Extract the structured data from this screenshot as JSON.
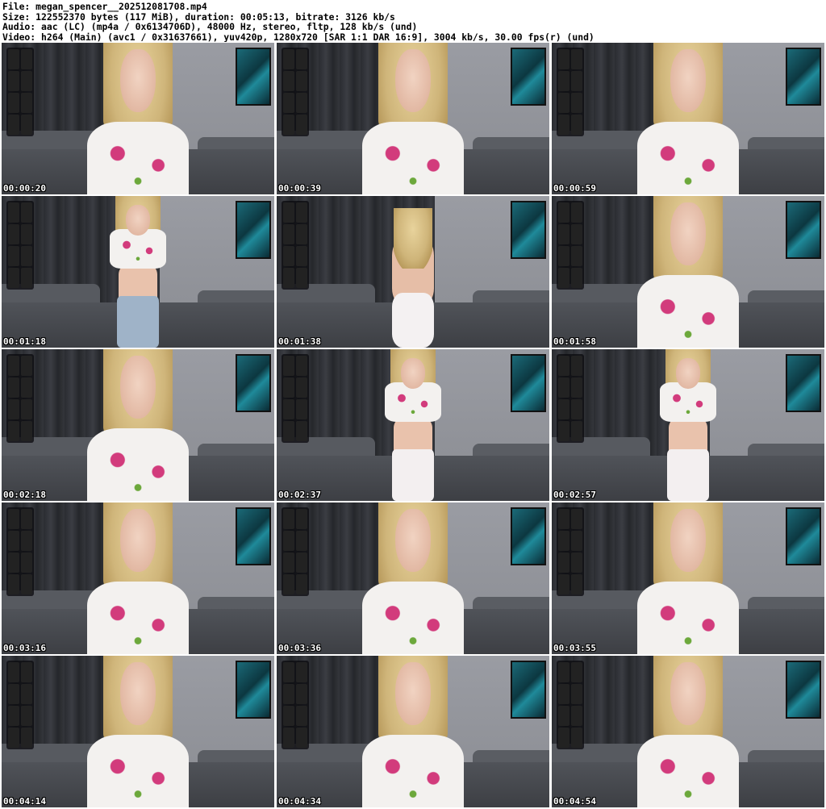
{
  "header": {
    "file": "File: megan_spencer__202512081708.mp4",
    "size": "Size: 122552370 bytes (117 MiB), duration: 00:05:13, bitrate: 3126 kb/s",
    "audio": "Audio: aac (LC) (mp4a / 0x6134706D), 48000 Hz, stereo, fltp, 128 kb/s (und)",
    "video": "Video: h264 (Main) (avc1 / 0x31637661), yuv420p, 1280x720 [SAR 1:1 DAR 16:9], 3004 kb/s, 30.00 fps(r) (und)"
  },
  "thumbnails": [
    {
      "time": "00:00:20",
      "pose": "closeup"
    },
    {
      "time": "00:00:39",
      "pose": "closeup"
    },
    {
      "time": "00:00:59",
      "pose": "closeup"
    },
    {
      "time": "00:01:18",
      "pose": "full-jeans"
    },
    {
      "time": "00:01:38",
      "pose": "back"
    },
    {
      "time": "00:01:58",
      "pose": "closeup"
    },
    {
      "time": "00:02:18",
      "pose": "closeup"
    },
    {
      "time": "00:02:37",
      "pose": "full"
    },
    {
      "time": "00:02:57",
      "pose": "full"
    },
    {
      "time": "00:03:16",
      "pose": "closeup"
    },
    {
      "time": "00:03:36",
      "pose": "closeup"
    },
    {
      "time": "00:03:55",
      "pose": "closeup"
    },
    {
      "time": "00:04:14",
      "pose": "closeup"
    },
    {
      "time": "00:04:34",
      "pose": "closeup"
    },
    {
      "time": "00:04:54",
      "pose": "closeup"
    }
  ],
  "colors": {
    "timestamp": "#ffffff",
    "shirt_accent": "#d23b7c",
    "curtain": "#2a2c31",
    "wall": "#9a9ca3"
  }
}
